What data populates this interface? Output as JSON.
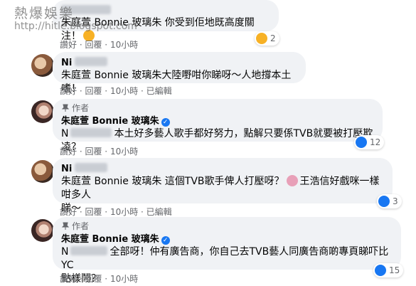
{
  "watermark": {
    "line1": "熱爆娛樂",
    "line2": "http://hitle.blogspot.com"
  },
  "comments": [
    {
      "name": "",
      "text": "朱庭萱 Bonnie 玻璃朱 你受到佢地既高度關注！",
      "actions": [
        "讚好",
        "回覆",
        "10小時"
      ],
      "reaction_count": "2"
    },
    {
      "name": "Ni",
      "text": "朱庭萱 Bonnie 玻璃朱大陸嘢咁你睇呀～人地撐本土嗜！",
      "actions": [
        "讚好",
        "回覆",
        "10小時",
        "已編輯"
      ]
    },
    {
      "author_badge": "作者",
      "name": "朱庭萱 Bonnie 玻璃朱",
      "text_prefix": "N",
      "text": "本土好多藝人歌手都好努力，點解只要係TVB就要被打壓欺凌？",
      "actions": [
        "讚好",
        "回覆",
        "10小時"
      ],
      "reaction_count": "12"
    },
    {
      "name": "Ni",
      "text_line1": "朱庭萱 Bonnie 玻璃朱 這個TVB歌手俾人打壓呀？",
      "text_line1b": "王浩信好戲咪一樣咁多人",
      "text_line2": "睇～",
      "actions": [
        "讚好",
        "回覆",
        "10小時",
        "已編輯"
      ],
      "reaction_count": "3"
    },
    {
      "author_badge": "作者",
      "name": "朱庭萱 Bonnie 玻璃朱",
      "text_prefix": "N",
      "text_line1": "全部呀！仲有廣告商，你自己去TVB藝人同廣告商啲專頁睇吓比YC",
      "text_line2": "點樣鬧？",
      "actions": [
        "讚好",
        "回覆",
        "10小時"
      ],
      "reaction_count": "15"
    }
  ],
  "separator": " · ",
  "colors": {
    "bubble": "#f0f2f5",
    "meta": "#65676b",
    "like": "#1877f2"
  },
  "icons": [
    "verified-badge-icon",
    "pin-icon",
    "like-icon",
    "haha-icon",
    "laughing-emoji-icon",
    "person-emoji-icon"
  ]
}
